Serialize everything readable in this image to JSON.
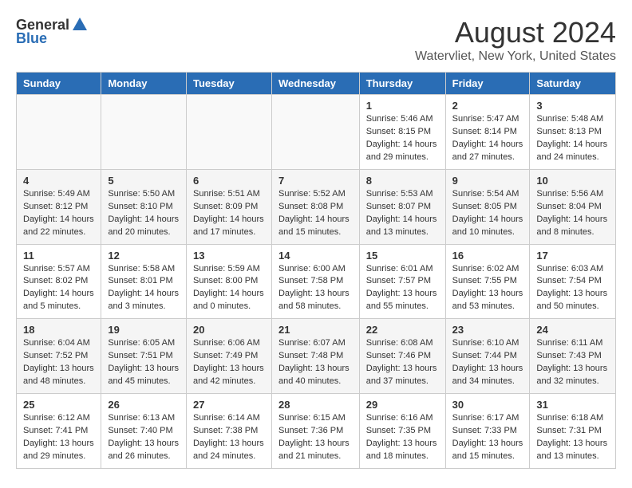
{
  "header": {
    "logo_general": "General",
    "logo_blue": "Blue",
    "title": "August 2024",
    "subtitle": "Watervliet, New York, United States"
  },
  "columns": [
    "Sunday",
    "Monday",
    "Tuesday",
    "Wednesday",
    "Thursday",
    "Friday",
    "Saturday"
  ],
  "weeks": [
    {
      "days": [
        {
          "num": "",
          "info": ""
        },
        {
          "num": "",
          "info": ""
        },
        {
          "num": "",
          "info": ""
        },
        {
          "num": "",
          "info": ""
        },
        {
          "num": "1",
          "info": "Sunrise: 5:46 AM\nSunset: 8:15 PM\nDaylight: 14 hours and 29 minutes."
        },
        {
          "num": "2",
          "info": "Sunrise: 5:47 AM\nSunset: 8:14 PM\nDaylight: 14 hours and 27 minutes."
        },
        {
          "num": "3",
          "info": "Sunrise: 5:48 AM\nSunset: 8:13 PM\nDaylight: 14 hours and 24 minutes."
        }
      ]
    },
    {
      "days": [
        {
          "num": "4",
          "info": "Sunrise: 5:49 AM\nSunset: 8:12 PM\nDaylight: 14 hours and 22 minutes."
        },
        {
          "num": "5",
          "info": "Sunrise: 5:50 AM\nSunset: 8:10 PM\nDaylight: 14 hours and 20 minutes."
        },
        {
          "num": "6",
          "info": "Sunrise: 5:51 AM\nSunset: 8:09 PM\nDaylight: 14 hours and 17 minutes."
        },
        {
          "num": "7",
          "info": "Sunrise: 5:52 AM\nSunset: 8:08 PM\nDaylight: 14 hours and 15 minutes."
        },
        {
          "num": "8",
          "info": "Sunrise: 5:53 AM\nSunset: 8:07 PM\nDaylight: 14 hours and 13 minutes."
        },
        {
          "num": "9",
          "info": "Sunrise: 5:54 AM\nSunset: 8:05 PM\nDaylight: 14 hours and 10 minutes."
        },
        {
          "num": "10",
          "info": "Sunrise: 5:56 AM\nSunset: 8:04 PM\nDaylight: 14 hours and 8 minutes."
        }
      ]
    },
    {
      "days": [
        {
          "num": "11",
          "info": "Sunrise: 5:57 AM\nSunset: 8:02 PM\nDaylight: 14 hours and 5 minutes."
        },
        {
          "num": "12",
          "info": "Sunrise: 5:58 AM\nSunset: 8:01 PM\nDaylight: 14 hours and 3 minutes."
        },
        {
          "num": "13",
          "info": "Sunrise: 5:59 AM\nSunset: 8:00 PM\nDaylight: 14 hours and 0 minutes."
        },
        {
          "num": "14",
          "info": "Sunrise: 6:00 AM\nSunset: 7:58 PM\nDaylight: 13 hours and 58 minutes."
        },
        {
          "num": "15",
          "info": "Sunrise: 6:01 AM\nSunset: 7:57 PM\nDaylight: 13 hours and 55 minutes."
        },
        {
          "num": "16",
          "info": "Sunrise: 6:02 AM\nSunset: 7:55 PM\nDaylight: 13 hours and 53 minutes."
        },
        {
          "num": "17",
          "info": "Sunrise: 6:03 AM\nSunset: 7:54 PM\nDaylight: 13 hours and 50 minutes."
        }
      ]
    },
    {
      "days": [
        {
          "num": "18",
          "info": "Sunrise: 6:04 AM\nSunset: 7:52 PM\nDaylight: 13 hours and 48 minutes."
        },
        {
          "num": "19",
          "info": "Sunrise: 6:05 AM\nSunset: 7:51 PM\nDaylight: 13 hours and 45 minutes."
        },
        {
          "num": "20",
          "info": "Sunrise: 6:06 AM\nSunset: 7:49 PM\nDaylight: 13 hours and 42 minutes."
        },
        {
          "num": "21",
          "info": "Sunrise: 6:07 AM\nSunset: 7:48 PM\nDaylight: 13 hours and 40 minutes."
        },
        {
          "num": "22",
          "info": "Sunrise: 6:08 AM\nSunset: 7:46 PM\nDaylight: 13 hours and 37 minutes."
        },
        {
          "num": "23",
          "info": "Sunrise: 6:10 AM\nSunset: 7:44 PM\nDaylight: 13 hours and 34 minutes."
        },
        {
          "num": "24",
          "info": "Sunrise: 6:11 AM\nSunset: 7:43 PM\nDaylight: 13 hours and 32 minutes."
        }
      ]
    },
    {
      "days": [
        {
          "num": "25",
          "info": "Sunrise: 6:12 AM\nSunset: 7:41 PM\nDaylight: 13 hours and 29 minutes."
        },
        {
          "num": "26",
          "info": "Sunrise: 6:13 AM\nSunset: 7:40 PM\nDaylight: 13 hours and 26 minutes."
        },
        {
          "num": "27",
          "info": "Sunrise: 6:14 AM\nSunset: 7:38 PM\nDaylight: 13 hours and 24 minutes."
        },
        {
          "num": "28",
          "info": "Sunrise: 6:15 AM\nSunset: 7:36 PM\nDaylight: 13 hours and 21 minutes."
        },
        {
          "num": "29",
          "info": "Sunrise: 6:16 AM\nSunset: 7:35 PM\nDaylight: 13 hours and 18 minutes."
        },
        {
          "num": "30",
          "info": "Sunrise: 6:17 AM\nSunset: 7:33 PM\nDaylight: 13 hours and 15 minutes."
        },
        {
          "num": "31",
          "info": "Sunrise: 6:18 AM\nSunset: 7:31 PM\nDaylight: 13 hours and 13 minutes."
        }
      ]
    }
  ]
}
